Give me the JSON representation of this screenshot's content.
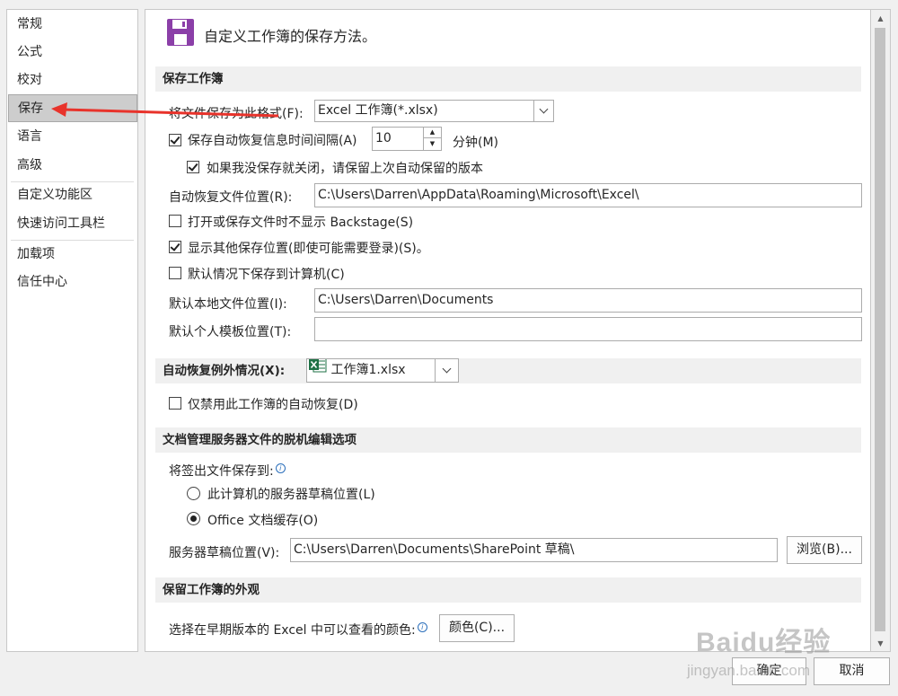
{
  "sidebar": {
    "items": [
      {
        "label": "常规"
      },
      {
        "label": "公式"
      },
      {
        "label": "校对"
      },
      {
        "label": "保存"
      },
      {
        "label": "语言"
      },
      {
        "label": "高级"
      },
      {
        "label": "自定义功能区"
      },
      {
        "label": "快速访问工具栏"
      },
      {
        "label": "加载项"
      },
      {
        "label": "信任中心"
      }
    ],
    "selected": "保存"
  },
  "header": {
    "title": "自定义工作簿的保存方法。",
    "icon": "save-icon",
    "icon_color": "#8b3fa8"
  },
  "save_section": {
    "title": "保存工作簿",
    "format_label": "将文件保存为此格式(F):",
    "format_value": "Excel 工作簿(*.xlsx)",
    "autorecover_label": "保存自动恢复信息时间间隔(A)",
    "autorecover_checked": true,
    "autorecover_minutes": "10",
    "minutes_label": "分钟(M)",
    "keep_last_label": "如果我没保存就关闭，请保留上次自动保留的版本",
    "keep_last_checked": true,
    "autorecover_location_label": "自动恢复文件位置(R):",
    "autorecover_location_value": "C:\\Users\\Darren\\AppData\\Roaming\\Microsoft\\Excel\\",
    "no_backstage_label": "打开或保存文件时不显示 Backstage(S)",
    "no_backstage_checked": false,
    "show_additional_label": "显示其他保存位置(即使可能需要登录)(S)。",
    "show_additional_checked": true,
    "save_to_computer_label": "默认情况下保存到计算机(C)",
    "save_to_computer_checked": false,
    "local_location_label": "默认本地文件位置(I):",
    "local_location_value": "C:\\Users\\Darren\\Documents",
    "template_location_label": "默认个人模板位置(T):",
    "template_location_value": ""
  },
  "exceptions_section": {
    "title": "自动恢复例外情况(X):",
    "workbook_value": "工作簿1.xlsx",
    "disable_label": "仅禁用此工作簿的自动恢复(D)",
    "disable_checked": false
  },
  "offline_section": {
    "title": "文档管理服务器文件的脱机编辑选项",
    "save_checked_out_label": "将签出文件保存到:",
    "server_drafts_radio_label": "此计算机的服务器草稿位置(L)",
    "server_drafts_radio_checked": false,
    "office_cache_radio_label": "Office 文档缓存(O)",
    "office_cache_radio_checked": true,
    "server_drafts_location_label": "服务器草稿位置(V):",
    "server_drafts_location_value": "C:\\Users\\Darren\\Documents\\SharePoint 草稿\\",
    "browse_label": "浏览(B)..."
  },
  "appearance_section": {
    "title": "保留工作簿的外观",
    "colors_label": "选择在早期版本的 Excel 中可以查看的颜色:",
    "colors_button": "颜色(C)..."
  },
  "footer": {
    "ok_label": "确定",
    "cancel_label": "取消"
  },
  "watermark": {
    "brand": "Baidu经验",
    "url": "jingyan.baidu.com"
  },
  "annotation": {
    "arrow_color": "#e8332b"
  }
}
